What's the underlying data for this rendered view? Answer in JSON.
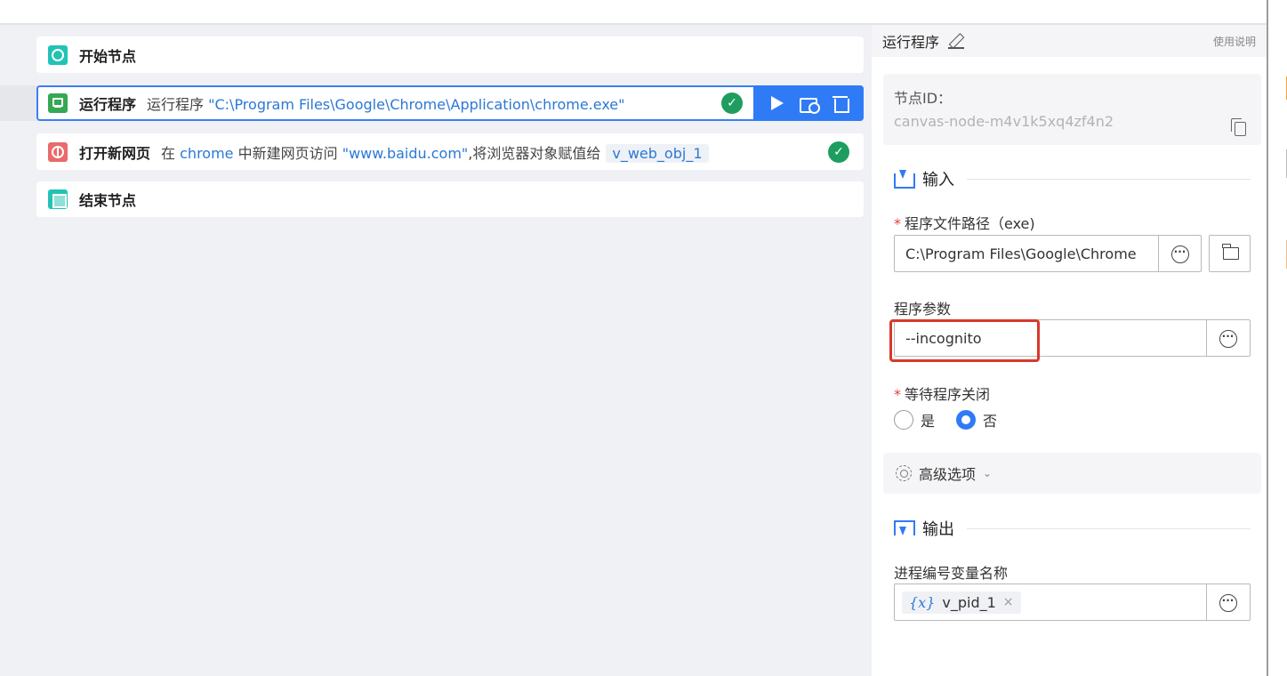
{
  "flow": {
    "nodes": [
      {
        "title": "开始节点"
      },
      {
        "title": "运行程序",
        "desc_prefix": "运行程序",
        "desc_path": "\"C:\\Program Files\\Google\\Chrome\\Application\\chrome.exe\""
      },
      {
        "title": "打开新网页",
        "desc_in": "在",
        "desc_browser": "chrome",
        "desc_mid": "中新建网页访问",
        "desc_url": "\"www.baidu.com\"",
        "desc_tail": ",将浏览器对象赋值给",
        "desc_var": "v_web_obj_1"
      },
      {
        "title": "结束节点"
      }
    ],
    "check_glyph": "✓"
  },
  "panel": {
    "title": "运行程序",
    "help": "使用说明",
    "node_id_label": "节点ID：",
    "node_id_value": "canvas-node-m4v1k5xq4zf4n2",
    "input_section": "输入",
    "program_path_label": "程序文件路径（exe)",
    "program_path_value": "C:\\Program Files\\Google\\Chrome",
    "program_args_label": "程序参数",
    "program_args_value": "--incognito",
    "wait_label": "等待程序关闭",
    "wait_yes": "是",
    "wait_no": "否",
    "wait_selected": "否",
    "advanced": "高级选项",
    "output_section": "输出",
    "pid_var_label": "进程编号变量名称",
    "pid_var_symbol": "{x}",
    "pid_var_value": "v_pid_1",
    "chip_close": "×",
    "required_mark": "*"
  },
  "colors": {
    "accent": "#2f7bf6",
    "success": "#1e9e5e",
    "highlight": "#d9382b"
  }
}
